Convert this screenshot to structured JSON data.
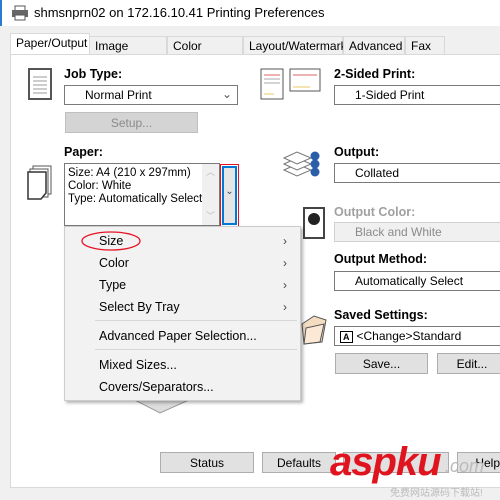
{
  "window": {
    "title": "shmsnprn02 on 172.16.10.41 Printing Preferences"
  },
  "tabs": [
    {
      "label": "Paper/Output",
      "active": true
    },
    {
      "label": "Image Options"
    },
    {
      "label": "Color Options"
    },
    {
      "label": "Layout/Watermark"
    },
    {
      "label": "Advanced"
    },
    {
      "label": "Fax"
    }
  ],
  "job_type": {
    "label": "Job Type:",
    "value": "Normal Print",
    "setup_label": "Setup..."
  },
  "two_sided": {
    "label": "2-Sided Print:",
    "value": "1-Sided Print"
  },
  "paper": {
    "label": "Paper:",
    "lines": [
      "Size: A4 (210 x 297mm)",
      "Color: White",
      "Type: Automatically Select"
    ]
  },
  "output": {
    "label": "Output:",
    "value": "Collated"
  },
  "output_color": {
    "label": "Output Color:",
    "value": "Black and White"
  },
  "output_method": {
    "label": "Output Method:",
    "value": "Automatically Select"
  },
  "saved_settings": {
    "label": "Saved Settings:",
    "value": "<Change>Standard",
    "icon_letter": "A",
    "save_label": "Save...",
    "edit_label": "Edit..."
  },
  "menu": {
    "items": [
      {
        "label": "Size",
        "submenu": true
      },
      {
        "label": "Color",
        "submenu": true
      },
      {
        "label": "Type",
        "submenu": true
      },
      {
        "label": "Select By Tray",
        "submenu": true
      },
      {
        "label": "Advanced Paper Selection..."
      },
      {
        "label": "Mixed Sizes..."
      },
      {
        "label": "Covers/Separators..."
      }
    ]
  },
  "footer": {
    "status_label": "Status",
    "defaults_label": "Defaults",
    "help_label": "Help"
  },
  "watermark": {
    "text": "aspku",
    "suffix": ".com",
    "sub": "免费网站源码下载站!"
  },
  "colors": {
    "accent": "#0078d7",
    "highlight": "#e81123",
    "watermark": "#e0141e"
  }
}
